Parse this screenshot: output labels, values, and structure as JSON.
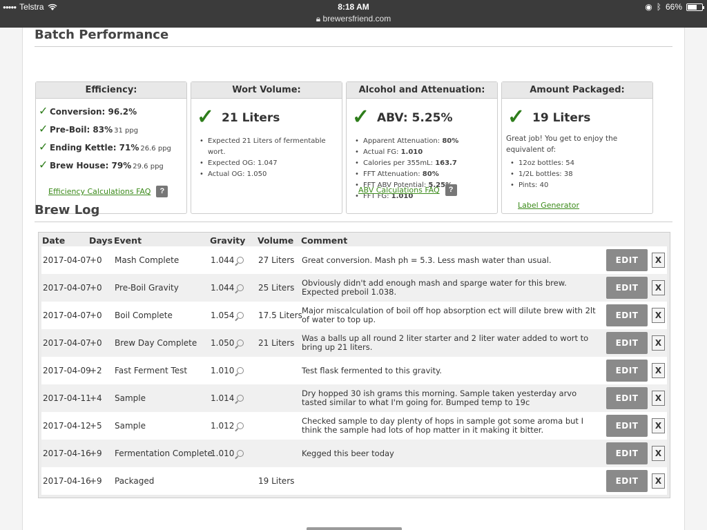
{
  "status_bar": {
    "carrier": "Telstra",
    "time": "8:18 AM",
    "url": "brewersfriend.com",
    "battery": "66%",
    "battery_level": 0.66
  },
  "batch_performance": {
    "title": "Batch Performance",
    "efficiency": {
      "header": "Efficiency:",
      "rows": [
        {
          "label": "Conversion: 96.2%",
          "sub": ""
        },
        {
          "label": "Pre-Boil: 83%",
          "sub": "31 ppg"
        },
        {
          "label": "Ending Kettle: 71%",
          "sub": "26.6 ppg"
        },
        {
          "label": "Brew House: 79%",
          "sub": "29.6 ppg"
        }
      ],
      "faq_link": "Efficiency Calculations FAQ",
      "help": "?"
    },
    "wort_volume": {
      "header": "Wort Volume:",
      "value": "21 Liters",
      "items": [
        "Expected 21 Liters of fermentable wort.",
        "Expected OG: 1.047",
        "Actual OG: 1.050"
      ]
    },
    "alcohol": {
      "header": "Alcohol and Attenuation:",
      "value": "ABV: 5.25%",
      "items": [
        {
          "label": "Apparent Attenuation: ",
          "value": "80%"
        },
        {
          "label": "Actual FG: ",
          "value": "1.010"
        },
        {
          "label": "Calories per 355mL: ",
          "value": "163.7"
        },
        {
          "label": "FFT Attenuation: ",
          "value": "80%"
        },
        {
          "label": "FFT ABV Potential: ",
          "value": "5.25%"
        },
        {
          "label": "FFT FG: ",
          "value": "1.010"
        }
      ],
      "faq_link": "ABV Calculations FAQ",
      "help": "?"
    },
    "packaged": {
      "header": "Amount Packaged:",
      "value": "19 Liters",
      "message": "Great job! You get to enjoy the equivalent of:",
      "items": [
        "12oz bottles: 54",
        "1/2L bottles: 38",
        "Pints: 40"
      ],
      "link": "Label Generator"
    }
  },
  "brew_log": {
    "title": "Brew Log",
    "columns": [
      "Date",
      "Days",
      "Event",
      "Gravity",
      "Volume",
      "Comment"
    ],
    "edit_label": "EDIT",
    "delete_label": "X",
    "rows": [
      {
        "date": "2017-04-07",
        "days": "+0",
        "event": "Mash Complete",
        "gravity": "1.044",
        "volume": "27 Liters",
        "comment": "Great conversion. Mash ph = 5.3. Less mash water than usual."
      },
      {
        "date": "2017-04-07",
        "days": "+0",
        "event": "Pre-Boil Gravity",
        "gravity": "1.044",
        "volume": "25 Liters",
        "comment": "Obviously didn't add enough mash and sparge water for this brew. Expected preboil 1.038."
      },
      {
        "date": "2017-04-07",
        "days": "+0",
        "event": "Boil Complete",
        "gravity": "1.054",
        "volume": "17.5 Liters",
        "comment": "Major miscalculation of boil off hop absorption ect will dilute brew with 2lt of water to top up."
      },
      {
        "date": "2017-04-07",
        "days": "+0",
        "event": "Brew Day Complete",
        "gravity": "1.050",
        "volume": "21 Liters",
        "comment": "Was a balls up all round 2 liter starter and 2 liter water added to wort to bring up 21 liters."
      },
      {
        "date": "2017-04-09",
        "days": "+2",
        "event": "Fast Ferment Test",
        "gravity": "1.010",
        "volume": "",
        "comment": "Test flask fermented to this gravity."
      },
      {
        "date": "2017-04-11",
        "days": "+4",
        "event": "Sample",
        "gravity": "1.014",
        "volume": "",
        "comment": "Dry hopped 30 ish grams this morning. Sample taken yesterday arvo tasted similar to what I'm going for. Bumped temp to 19c"
      },
      {
        "date": "2017-04-12",
        "days": "+5",
        "event": "Sample",
        "gravity": "1.012",
        "volume": "",
        "comment": "Checked sample to day plenty of hops in sample got some aroma but I think the sample had lots of hop matter in it making it bitter."
      },
      {
        "date": "2017-04-16",
        "days": "+9",
        "event": "Fermentation Complete",
        "gravity": "1.010",
        "volume": "",
        "comment": "Kegged this beer today"
      },
      {
        "date": "2017-04-16",
        "days": "+9",
        "event": "Packaged",
        "gravity": "",
        "volume": "19 Liters",
        "comment": ""
      }
    ]
  }
}
